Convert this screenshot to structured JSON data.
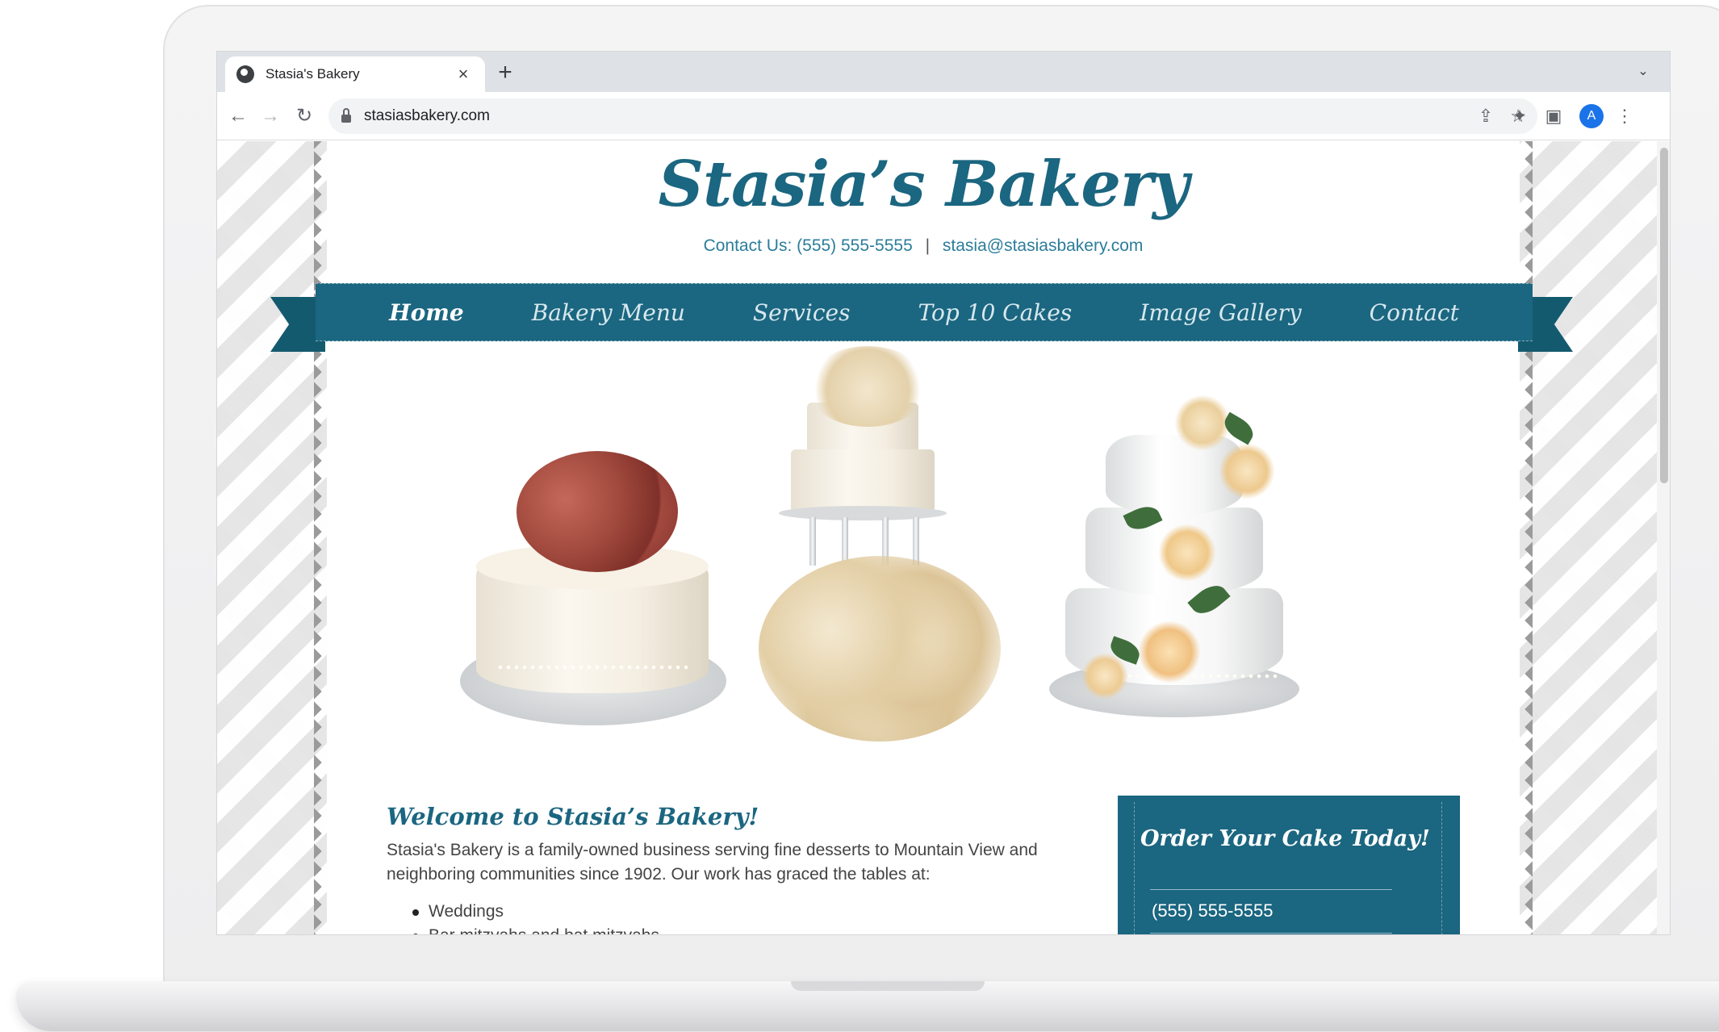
{
  "browser": {
    "tab_title": "Stasia's Bakery",
    "url": "stasiasbakery.com",
    "avatar_letter": "A"
  },
  "site": {
    "title": "Stasia’s Bakery",
    "contact_label": "Contact Us:",
    "phone": "(555) 555-5555",
    "separator": "|",
    "email": "stasia@stasiasbakery.com"
  },
  "nav": {
    "items": [
      "Home",
      "Bakery Menu",
      "Services",
      "Top 10 Cakes",
      "Image Gallery",
      "Contact"
    ],
    "active": "Home"
  },
  "welcome": {
    "title": "Welcome to Stasia’s Bakery!",
    "body": "Stasia's Bakery is a family-owned business serving fine desserts to Mountain View and neighboring communities since 1902. Our work has graced the tables at:",
    "bullets": [
      "Weddings",
      "Bar mitzvahs and bat mitzvahs"
    ]
  },
  "order": {
    "title": "Order Your Cake Today!",
    "phone": "(555) 555-5555"
  },
  "colors": {
    "brand_teal": "#1b6680",
    "ribbon_dark": "#145a6f",
    "link_blue": "#2b7d9a"
  }
}
